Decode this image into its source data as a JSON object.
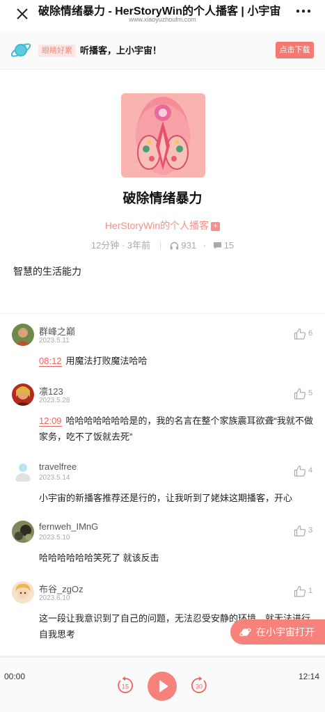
{
  "nav": {
    "title": "破除情绪暴力 - HerStoryWin的个人播客 | 小宇宙",
    "url": "www.xiaoyuzhoufm.com"
  },
  "banner": {
    "tag": "眼睛好累",
    "slogan": "听播客，上小宇宙！",
    "download_label": "点击下载"
  },
  "episode": {
    "title": "破除情绪暴力",
    "podcast": "HerStoryWin的个人播客",
    "plus_icon": "+",
    "duration": "12分钟",
    "published": "3年前",
    "meta_dot": "·",
    "plays": "931",
    "comments_count": "15",
    "description": "智慧的生活能力"
  },
  "comments": [
    {
      "name": "群峰之巅",
      "date": "2023.5.11",
      "likes": "6",
      "timestamp": "08:12",
      "text": "用魔法打败魔法哈哈"
    },
    {
      "name": "凛123",
      "date": "2023.5.28",
      "likes": "5",
      "timestamp": "12:09",
      "text": "哈哈哈哈哈哈哈是的，我的名言在整个家族震耳欲聋“我就不做家务，吃不了饭就去死”"
    },
    {
      "name": "travelfree",
      "date": "2023.5.14",
      "likes": "4",
      "timestamp": "",
      "text": "小宇宙的新播客推荐还是行的，让我听到了姥妹这期播客，开心"
    },
    {
      "name": "fernweh_IMnG",
      "date": "2023.5.10",
      "likes": "3",
      "timestamp": "",
      "text": "哈哈哈哈哈哈笑死了 就该反击"
    },
    {
      "name": "布谷_zgOz",
      "date": "2023.6.10",
      "likes": "1",
      "timestamp": "",
      "text": "这一段让我意识到了自己的问题，无法忍受安静的环境，就无法进行自我思考"
    }
  ],
  "open_app": {
    "label": "在小宇宙打开"
  },
  "player": {
    "current": "00:00",
    "duration": "12:14",
    "progress": 0,
    "rewind": "15",
    "forward": "30"
  },
  "colors": {
    "accent": "#f6827b",
    "timestamp": "#f0635a",
    "podcast_link": "#f4918a"
  }
}
